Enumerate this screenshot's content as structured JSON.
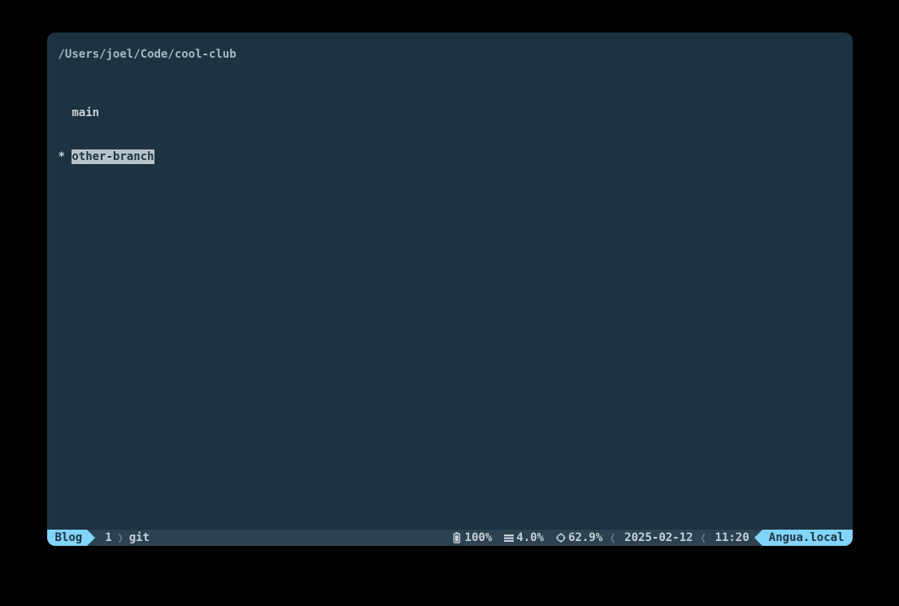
{
  "terminal": {
    "cwd": "/Users/joel/Code/cool-club",
    "branches": [
      {
        "indicator": "  ",
        "name": "main",
        "selected": false
      },
      {
        "indicator": "* ",
        "name": "other-branch",
        "selected": true
      }
    ]
  },
  "statusbar": {
    "session": "Blog",
    "window_index": "1",
    "window_name": "git",
    "battery": "100%",
    "cpu": "4.0%",
    "memory": "62.9%",
    "date": "2025-02-12",
    "time": "11:20",
    "host": "Angua.local"
  }
}
